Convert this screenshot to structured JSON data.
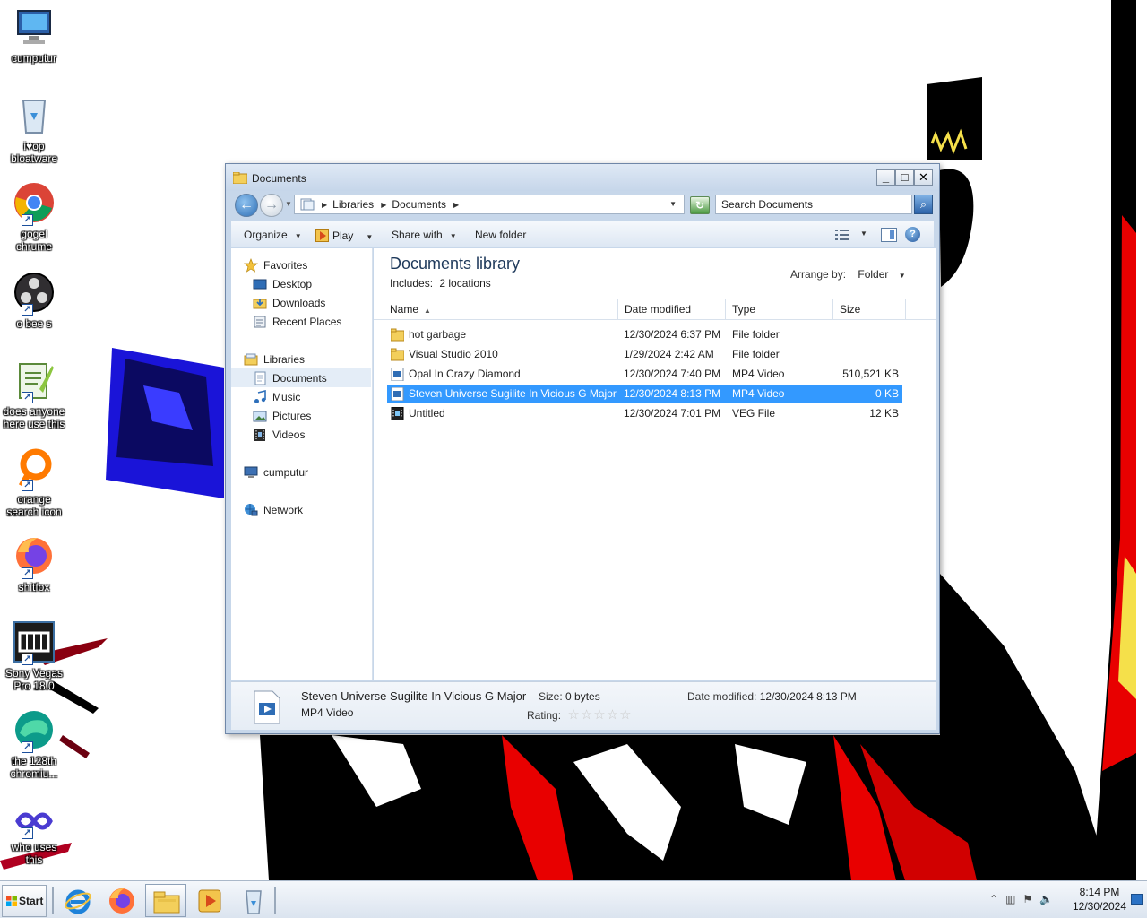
{
  "desktop": {
    "icons": [
      {
        "label": "cumputur",
        "icon": "computer-icon"
      },
      {
        "label": "i♥op bloatware",
        "icon": "recycle-bin-icon"
      },
      {
        "label": "gogel chrume",
        "icon": "chrome-icon"
      },
      {
        "label": "o bee s",
        "icon": "obs-icon"
      },
      {
        "label": "does anyone here use this",
        "icon": "notepad-icon"
      },
      {
        "label": "orange search icon",
        "icon": "search-icon"
      },
      {
        "label": "shitfox",
        "icon": "firefox-icon"
      },
      {
        "label": "Sony Vegas Pro 18.0",
        "icon": "vegas-icon"
      },
      {
        "label": "the 128th chromiu...",
        "icon": "edge-icon"
      },
      {
        "label": "who uses this",
        "icon": "visual-studio-icon"
      }
    ]
  },
  "window": {
    "title": "Documents",
    "caption": {
      "minimize": "_",
      "maximize": "□",
      "close": "✕"
    },
    "address": {
      "crumbs": [
        "Libraries",
        "Documents"
      ]
    },
    "search_placeholder": "Search Documents",
    "toolbar": {
      "organize": "Organize",
      "play": "Play",
      "share_with": "Share with",
      "new_folder": "New folder"
    },
    "nav": {
      "favorites": {
        "label": "Favorites",
        "items": [
          "Desktop",
          "Downloads",
          "Recent Places"
        ]
      },
      "libraries": {
        "label": "Libraries",
        "items": [
          "Documents",
          "Music",
          "Pictures",
          "Videos"
        ]
      },
      "computer": "cumputur",
      "network": "Network",
      "selected": "Documents"
    },
    "library": {
      "title": "Documents library",
      "includes_label": "Includes:",
      "includes_value": "2 locations",
      "arrange_label": "Arrange by:",
      "arrange_value": "Folder"
    },
    "columns": [
      "Name",
      "Date modified",
      "Type",
      "Size"
    ],
    "files": [
      {
        "name": "hot garbage",
        "date": "12/30/2024 6:37 PM",
        "type": "File folder",
        "size": "",
        "icon": "folder-icon"
      },
      {
        "name": "Visual Studio 2010",
        "date": "1/29/2024 2:42 AM",
        "type": "File folder",
        "size": "",
        "icon": "folder-icon"
      },
      {
        "name": "Opal In Crazy Diamond",
        "date": "12/30/2024 7:40 PM",
        "type": "MP4 Video",
        "size": "510,521 KB",
        "icon": "video-file-icon"
      },
      {
        "name": "Steven Universe Sugilite In Vicious G Major",
        "date": "12/30/2024 8:13 PM",
        "type": "MP4 Video",
        "size": "0 KB",
        "icon": "video-file-icon",
        "selected": true
      },
      {
        "name": "Untitled",
        "date": "12/30/2024 7:01 PM",
        "type": "VEG File",
        "size": "12 KB",
        "icon": "veg-file-icon"
      }
    ],
    "details": {
      "name": "Steven Universe Sugilite In Vicious G Major",
      "type": "MP4 Video",
      "size_label": "Size:",
      "size_value": "0 bytes",
      "rating_label": "Rating:",
      "modified_label": "Date modified:",
      "modified_value": "12/30/2024 8:13 PM"
    }
  },
  "taskbar": {
    "start": "Start",
    "pinned": [
      "internet-explorer-icon",
      "firefox-icon",
      "explorer-icon",
      "media-player-icon",
      "recycle-bin-icon"
    ],
    "active": "explorer-icon",
    "clock": {
      "time": "8:14 PM",
      "date": "12/30/2024"
    }
  },
  "colors": {
    "selection": "#3399ff",
    "window_frame": "#c7d7ea",
    "accent_red": "#e80000",
    "accent_blue": "#1a14d8"
  }
}
